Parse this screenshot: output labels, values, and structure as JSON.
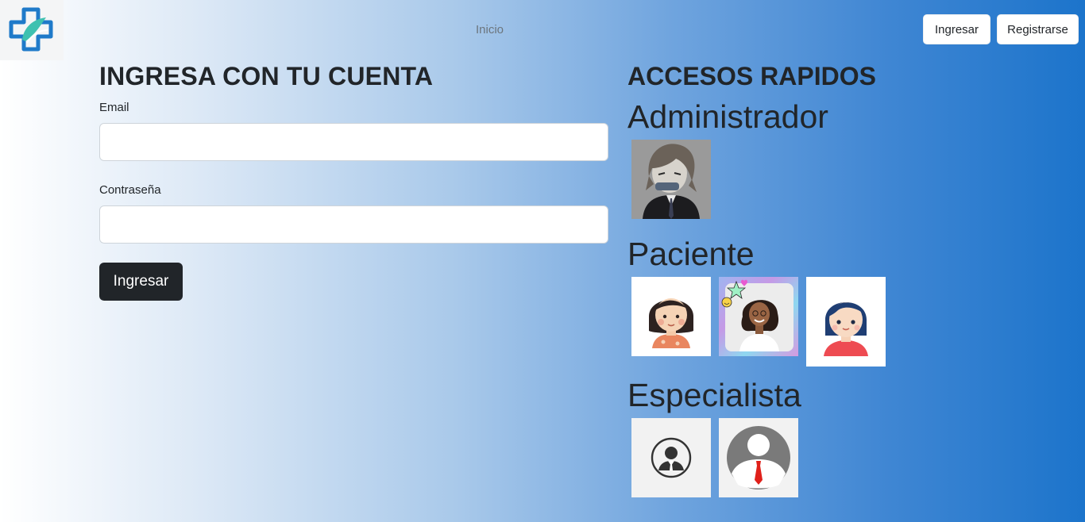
{
  "header": {
    "logo_icon": "medical-cross-logo-icon",
    "nav_link": "Inicio",
    "login_button": "Ingresar",
    "register_button": "Registrarse"
  },
  "login_form": {
    "title": "INGRESA CON TU CUENTA",
    "email_label": "Email",
    "email_value": "",
    "password_label": "Contraseña",
    "password_value": "",
    "submit_button": "Ingresar"
  },
  "quick_access": {
    "title": "ACCESOS RAPIDOS",
    "groups": [
      {
        "label": "Administrador",
        "avatars": [
          "anime-character-avatar"
        ]
      },
      {
        "label": "Paciente",
        "avatars": [
          "cartoon-girl-avatar",
          "smiling-woman-photo-avatar",
          "blue-hair-girl-avatar"
        ]
      },
      {
        "label": "Especialista",
        "avatars": [
          "businessman-outline-avatar",
          "red-tie-user-avatar"
        ]
      }
    ]
  },
  "colors": {
    "gradient_start": "#ffffff",
    "gradient_end": "#1c74cb",
    "primary_dark": "#212529",
    "logo_blue": "#1f7ac9",
    "logo_teal": "#3fc1b0"
  }
}
